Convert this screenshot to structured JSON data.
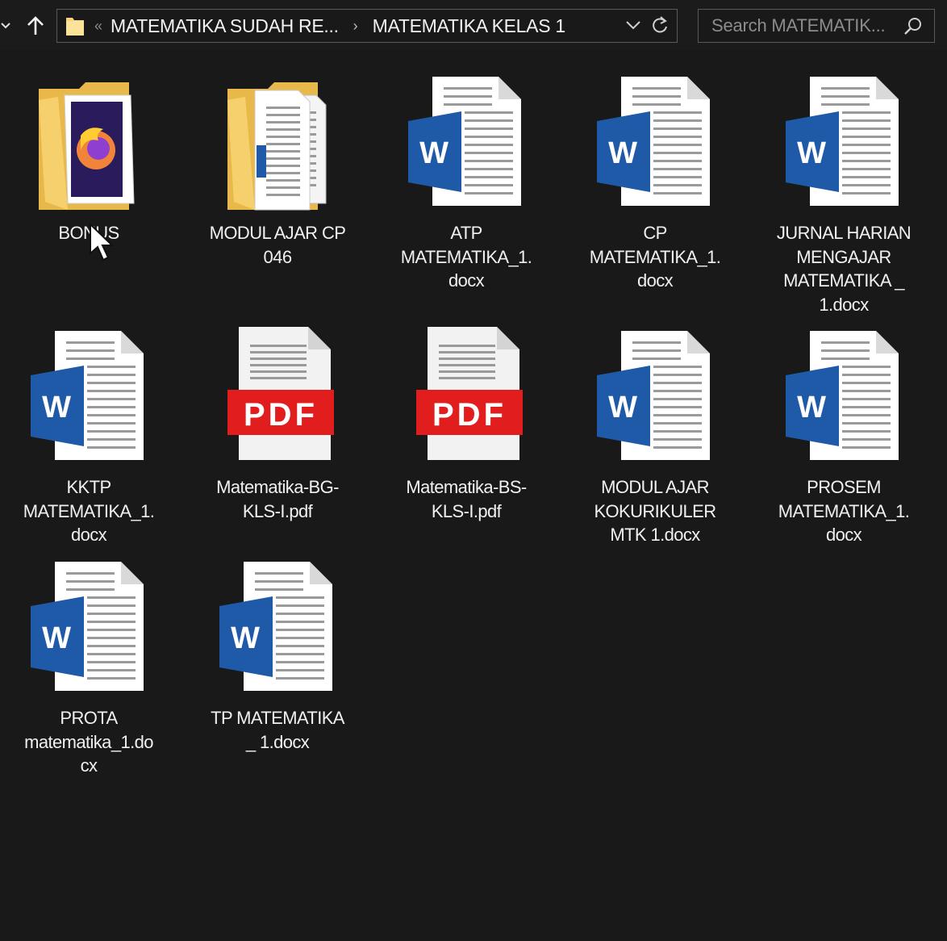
{
  "toolbar": {
    "breadcrumb_parent": "MATEMATIKA SUDAH RE...",
    "breadcrumb_current": "MATEMATIKA KELAS 1",
    "search_placeholder": "Search MATEMATIK..."
  },
  "items": [
    {
      "type": "folder-firefox",
      "lines": [
        "BONUS"
      ]
    },
    {
      "type": "folder-docs",
      "lines": [
        "MODUL AJAR CP",
        "046"
      ]
    },
    {
      "type": "word",
      "lines": [
        "ATP",
        "MATEMATIKA_1.",
        "docx"
      ]
    },
    {
      "type": "word",
      "lines": [
        "CP",
        "MATEMATIKA_1.",
        "docx"
      ]
    },
    {
      "type": "word",
      "lines": [
        "JURNAL HARIAN",
        "MENGAJAR",
        "MATEMATIKA _",
        "1.docx"
      ]
    },
    {
      "type": "word",
      "lines": [
        "KKTP",
        "MATEMATIKA_1.",
        "docx"
      ]
    },
    {
      "type": "pdf",
      "lines": [
        "Matematika-BG-",
        "KLS-I.pdf"
      ]
    },
    {
      "type": "pdf",
      "lines": [
        "Matematika-BS-",
        "KLS-I.pdf"
      ]
    },
    {
      "type": "word",
      "lines": [
        "MODUL AJAR",
        "KOKURIKULER",
        "MTK 1.docx"
      ]
    },
    {
      "type": "word",
      "lines": [
        "PROSEM",
        "MATEMATIKA_1.",
        "docx"
      ]
    },
    {
      "type": "word",
      "lines": [
        "PROTA",
        "matematika_1.do",
        "cx"
      ]
    },
    {
      "type": "word",
      "lines": [
        "TP MATEMATIKA",
        "_ 1.docx"
      ]
    }
  ],
  "icons": {
    "word_letter": "W",
    "pdf_text": "PDF",
    "word_blue": "#1f5aa8",
    "pdf_red": "#e11d1d",
    "folder_yellow": "#f5d06c"
  }
}
